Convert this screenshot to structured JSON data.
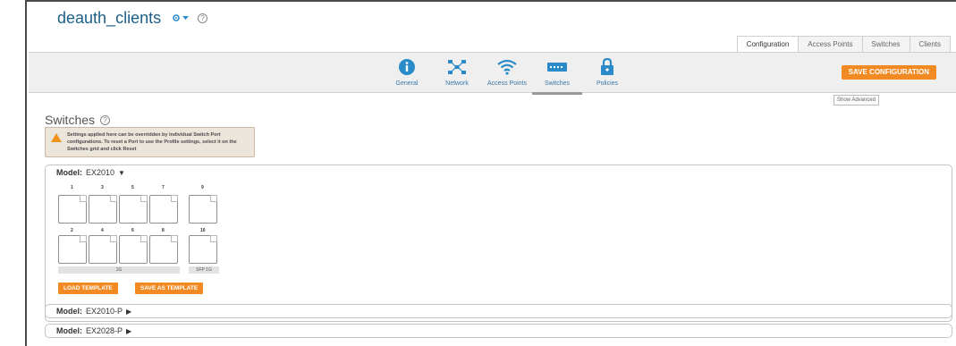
{
  "header": {
    "title": "deauth_clients",
    "gear_icon": "gear-icon",
    "dropdown_icon": "caret-down-icon",
    "help_glyph": "?"
  },
  "top_tabs": [
    {
      "label": "Configuration",
      "active": true
    },
    {
      "label": "Access Points",
      "active": false
    },
    {
      "label": "Switches",
      "active": false
    },
    {
      "label": "Clients",
      "active": false
    }
  ],
  "nav": [
    {
      "label": "General",
      "icon": "info-icon",
      "active": false
    },
    {
      "label": "Network",
      "icon": "network-icon",
      "active": false
    },
    {
      "label": "Access Points",
      "icon": "wifi-icon",
      "active": false
    },
    {
      "label": "Switches",
      "icon": "switch-icon",
      "active": true
    },
    {
      "label": "Policies",
      "icon": "lock-icon",
      "active": false
    }
  ],
  "save_configuration": "SAVE CONFIGURATION",
  "show_advanced": "Show Advanced",
  "section": {
    "title": "Switches",
    "notice": "Settings applied here can be overridden by individual Switch Port configurations. To reset a Port to use the Profile settings, select it on the Switches grid and click Reset"
  },
  "models": [
    {
      "key": "Model:",
      "name": "EX2010",
      "caret": "▼",
      "expanded": true,
      "ports_top": [
        "1",
        "3",
        "5",
        "7",
        "9"
      ],
      "ports_bottom": [
        "2",
        "4",
        "6",
        "8",
        "10"
      ],
      "speed_labels": [
        "1G",
        "SFP 1G"
      ],
      "load_template": "LOAD TEMPLATE",
      "save_template": "SAVE AS TEMPLATE"
    },
    {
      "key": "Model:",
      "name": "EX2010-P",
      "caret": "▶",
      "expanded": false
    },
    {
      "key": "Model:",
      "name": "EX2028-P",
      "caret": "▶",
      "expanded": false
    }
  ],
  "colors": {
    "accent": "#f28a24",
    "title": "#1d5f86",
    "nav_icon": "#2a8bc8"
  }
}
